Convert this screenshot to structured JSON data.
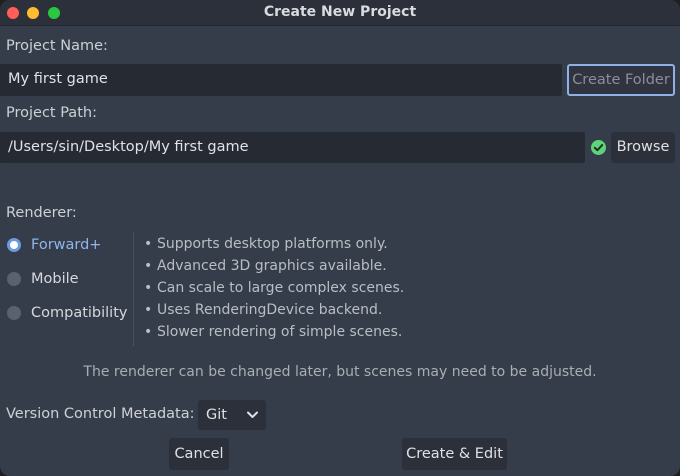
{
  "window": {
    "title": "Create New Project"
  },
  "project_name": {
    "label": "Project Name:",
    "value": "My first game",
    "create_folder_label": "Create Folder"
  },
  "project_path": {
    "label": "Project Path:",
    "value": "/Users/sin/Desktop/My first game",
    "browse_label": "Browse",
    "status_icon": "check-circle-icon",
    "status_color": "#5fd37a"
  },
  "renderer": {
    "label": "Renderer:",
    "options": [
      {
        "label": "Forward+",
        "selected": true
      },
      {
        "label": "Mobile",
        "selected": false
      },
      {
        "label": "Compatibility",
        "selected": false
      }
    ],
    "bullet_char": "•",
    "descriptions": [
      "Supports desktop platforms only.",
      "Advanced 3D graphics available.",
      "Can scale to large complex scenes.",
      "Uses RenderingDevice backend.",
      "Slower rendering of simple scenes."
    ],
    "note": "The renderer can be changed later, but scenes may need to be adjusted."
  },
  "version_control": {
    "label": "Version Control Metadata:",
    "selected": "Git"
  },
  "actions": {
    "cancel_label": "Cancel",
    "create_label": "Create & Edit"
  },
  "colors": {
    "accent": "#8fb5ec",
    "background": "#363d4a",
    "field_background": "#252a33"
  }
}
